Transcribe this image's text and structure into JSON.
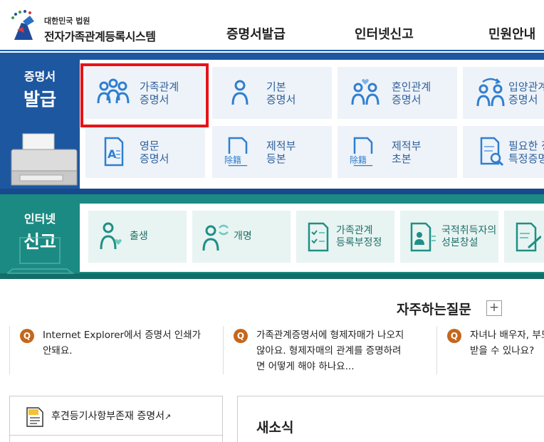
{
  "header": {
    "logo_sub": "대한민국 법원",
    "logo_title": "전자가족관계등록시스템",
    "nav": [
      "증명서발급",
      "인터넷신고",
      "민원안내"
    ]
  },
  "issue": {
    "label_line1": "증명서",
    "label_line2": "발급",
    "tiles": [
      {
        "line1": "가족관계",
        "line2": "증명서",
        "icon": "family-icon"
      },
      {
        "line1": "기본",
        "line2": "증명서",
        "icon": "person-icon"
      },
      {
        "line1": "혼인관계",
        "line2": "증명서",
        "icon": "couple-heart-icon"
      },
      {
        "line1": "입양관계",
        "line2": "증명서",
        "icon": "adoption-icon"
      },
      {
        "line1": "영문",
        "line2": "증명서",
        "icon": "english-document-icon"
      },
      {
        "line1": "제적부",
        "line2": "등본",
        "icon": "register-document-icon"
      },
      {
        "line1": "제적부",
        "line2": "초본",
        "icon": "register-document-icon"
      },
      {
        "line1": "필요한 정보만",
        "line2": "특정증명서",
        "icon": "search-document-icon"
      }
    ],
    "seal_text": "除籍"
  },
  "declare": {
    "label_line1": "인터넷",
    "label_line2": "신고",
    "tiles": [
      {
        "line1": "출생",
        "line2": "",
        "icon": "birth-icon"
      },
      {
        "line1": "개명",
        "line2": "",
        "icon": "rename-icon"
      },
      {
        "line1": "가족관계",
        "line2": "등록부정정",
        "icon": "checklist-icon"
      },
      {
        "line1": "국적취득자의",
        "line2": "성본창설",
        "icon": "id-card-icon"
      },
      {
        "line1": "",
        "line2": "",
        "icon": "write-icon"
      }
    ]
  },
  "faq": {
    "title": "자주하는질문",
    "more": "+",
    "badge": "Q",
    "items": [
      {
        "lines": [
          "Internet Explorer에서 증명서 인쇄가",
          "안돼요."
        ]
      },
      {
        "lines": [
          "가족관계증명서에 형제자매가 나오지",
          "않아요. 형제자매의 관계를 증명하려",
          "면 어떻게 해야 하나요..."
        ]
      },
      {
        "lines": [
          "자녀나 배우자, 부모가",
          "받을 수 있나요?"
        ]
      }
    ]
  },
  "bottom": {
    "cert_link": "후견등기사항부존재 증명서",
    "external_mark": "↗",
    "news_title": "새소식"
  },
  "colors": {
    "issue_blue": "#1d57a0",
    "declare_teal": "#1b8a82",
    "highlight_red": "#e5141a",
    "faq_badge": "#c4671d"
  }
}
